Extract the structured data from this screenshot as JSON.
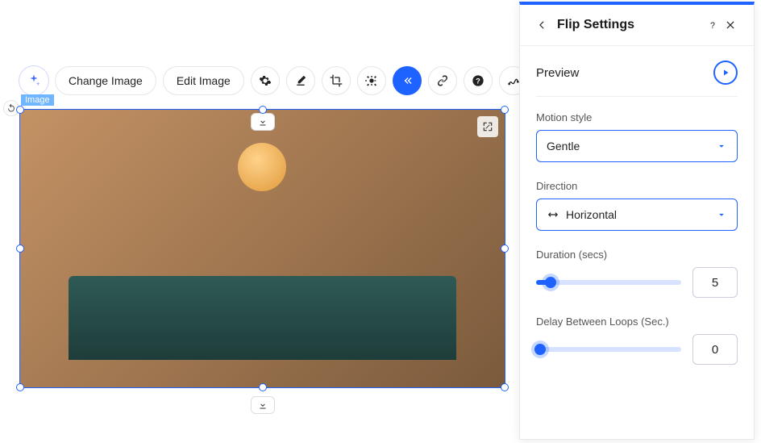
{
  "toolbar": {
    "change_image": "Change Image",
    "edit_image": "Edit Image"
  },
  "image_badge": "Image",
  "panel": {
    "title": "Flip Settings",
    "preview_label": "Preview",
    "motion_style": {
      "label": "Motion style",
      "value": "Gentle"
    },
    "direction": {
      "label": "Direction",
      "value": "Horizontal"
    },
    "duration": {
      "label": "Duration (secs)",
      "value": "5",
      "percent": 10
    },
    "delay": {
      "label": "Delay Between Loops (Sec.)",
      "value": "0",
      "percent": 0
    }
  }
}
